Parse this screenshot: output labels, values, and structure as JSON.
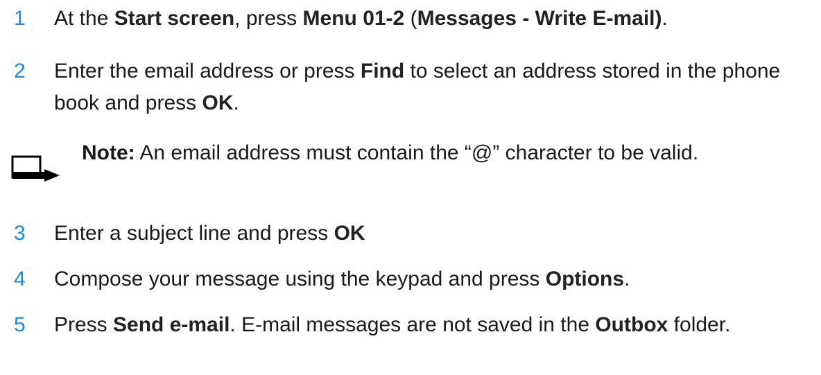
{
  "steps": [
    {
      "number": "1",
      "parts": [
        {
          "t": "At the ",
          "bold": false
        },
        {
          "t": "Start screen",
          "bold": true
        },
        {
          "t": ", press ",
          "bold": false
        },
        {
          "t": "Menu 01-2",
          "bold": true
        },
        {
          "t": " (",
          "bold": false
        },
        {
          "t": "Messages - Write E-mail)",
          "bold": true
        },
        {
          "t": ".",
          "bold": false
        }
      ]
    },
    {
      "number": "2",
      "parts": [
        {
          "t": "Enter the email address or press ",
          "bold": false
        },
        {
          "t": "Find",
          "bold": true
        },
        {
          "t": " to select an address stored in the phone book and press ",
          "bold": false
        },
        {
          "t": "OK",
          "bold": true
        },
        {
          "t": ".",
          "bold": false
        }
      ]
    },
    {
      "number": "3",
      "parts": [
        {
          "t": "Enter a subject line and press ",
          "bold": false
        },
        {
          "t": "OK",
          "bold": true
        }
      ]
    },
    {
      "number": "4",
      "parts": [
        {
          "t": "Compose your message using the keypad and press ",
          "bold": false
        },
        {
          "t": "Options",
          "bold": true
        },
        {
          "t": ".",
          "bold": false
        }
      ]
    },
    {
      "number": "5",
      "parts": [
        {
          "t": "Press ",
          "bold": false
        },
        {
          "t": "Send e-mail",
          "bold": true
        },
        {
          "t": ". E-mail messages are not saved in the ",
          "bold": false
        },
        {
          "t": "Outbox",
          "bold": true
        },
        {
          "t": " folder.",
          "bold": false
        }
      ]
    }
  ],
  "note": {
    "label": "Note:",
    "text": " An email address must contain the “@” character to be valid.",
    "icon": "note-icon"
  },
  "colors": {
    "step_number": "#1e88e5",
    "text": "#1a1a1a"
  }
}
